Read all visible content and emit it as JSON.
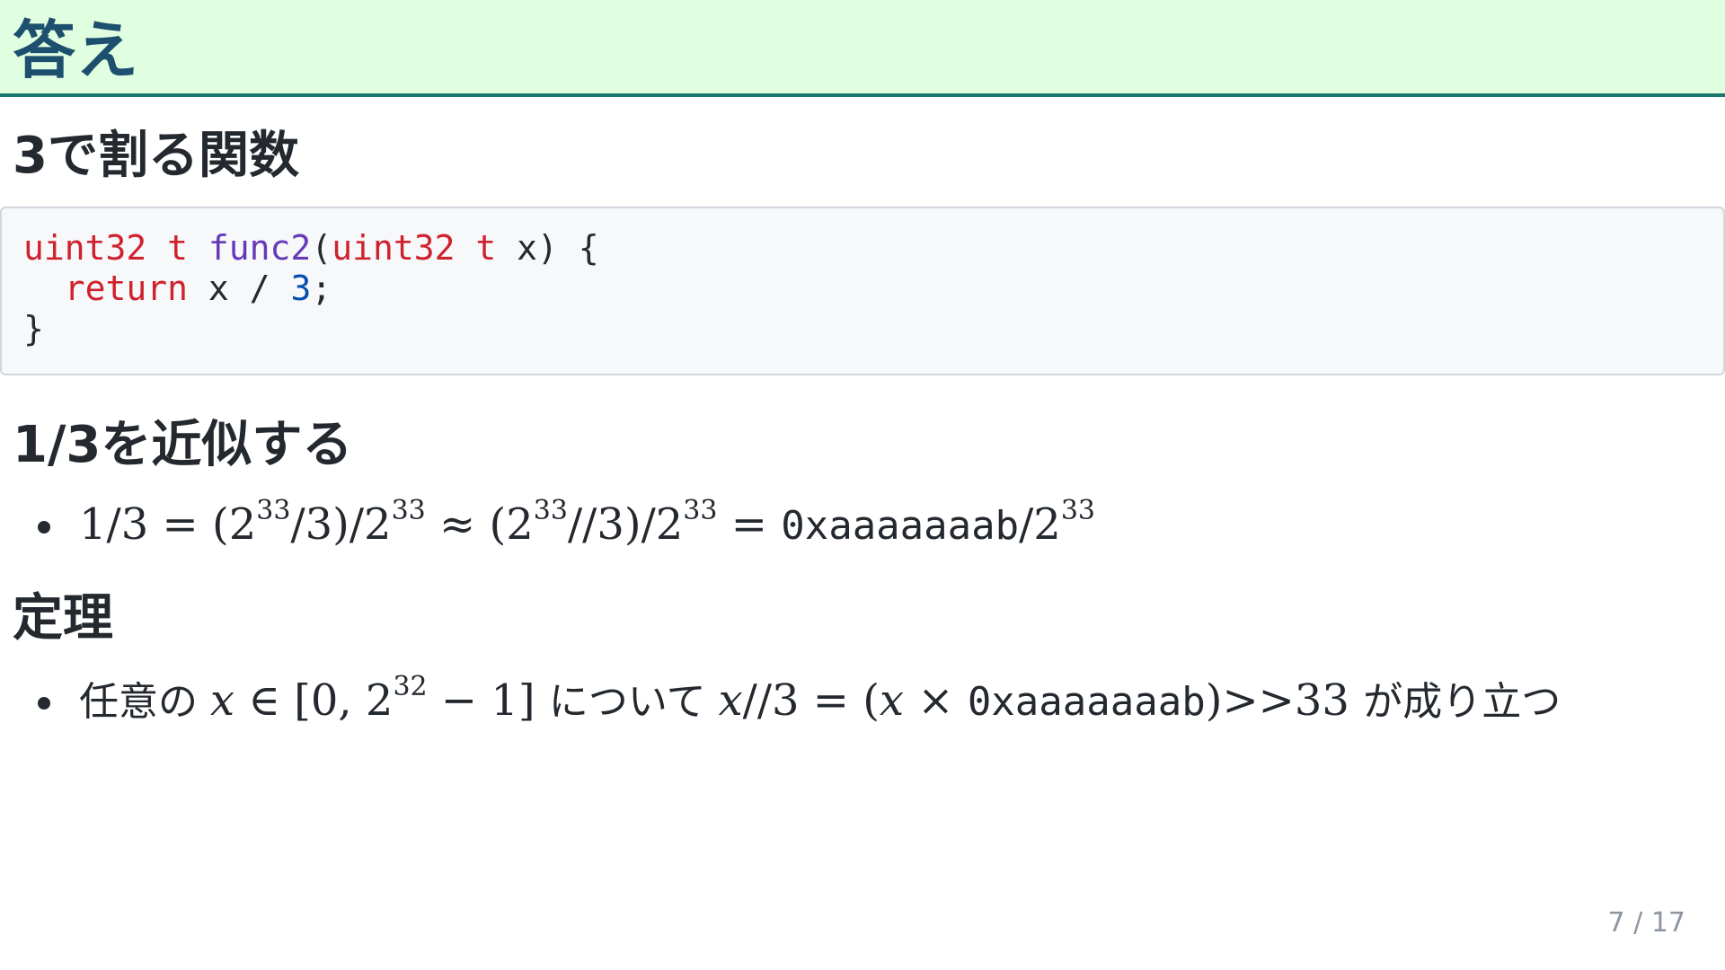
{
  "slide": {
    "title": "答え",
    "page_indicator": "7 / 17"
  },
  "section1": {
    "heading": "3で割る関数",
    "code": {
      "line1": {
        "type1": "uint32 t",
        "func": "func2",
        "open": "(",
        "type2": "uint32 t",
        "rest": " x) {"
      },
      "line2": {
        "indent": "  ",
        "keyword": "return",
        "middle": " x / ",
        "number": "3",
        "end": ";"
      },
      "line3": {
        "text": "}"
      }
    }
  },
  "section2": {
    "heading": "1/3を近似する",
    "formula": {
      "p1": "1/3 = (2",
      "e1": "33",
      "p2": "/3)/2",
      "e2": "33",
      "p3": " ≈ (2",
      "e3": "33",
      "p4": "//3)/2",
      "e4": "33",
      "p5": " = ",
      "hex": "0xaaaaaaab",
      "p6": "/2",
      "e5": "33"
    }
  },
  "section3": {
    "heading": "定理",
    "theorem": {
      "jp1": "任意の ",
      "x1": "x",
      "p1": " ∈ [0, 2",
      "e1": "32",
      "p2": " − 1] ",
      "jp2": "について ",
      "x2": "x",
      "p3": "//3 = (",
      "x3": "x",
      "p4": " × ",
      "hex": "0xaaaaaaab",
      "p5": ")>>33 ",
      "jp3": "が成り立つ"
    }
  }
}
